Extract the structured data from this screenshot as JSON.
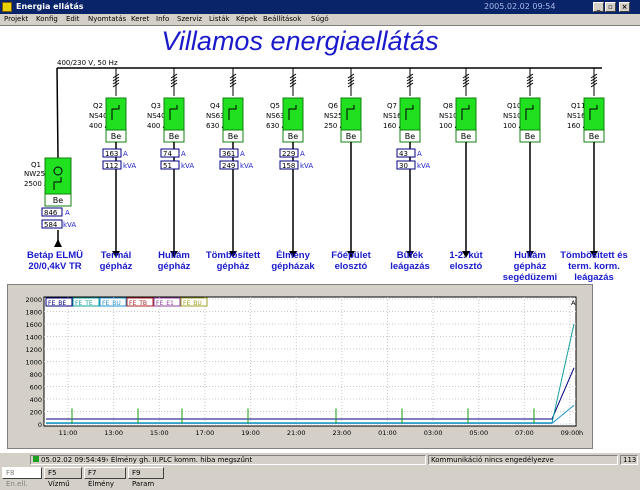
{
  "window": {
    "title": "Energia ellátás",
    "datetime": "2005.02.02  09:54"
  },
  "window_buttons": [
    "_",
    "▫",
    "×"
  ],
  "menu": [
    "Projekt",
    "Konfig",
    "Edit",
    "Nyomtatás",
    "Keret",
    "Info",
    "Szerviz",
    "Listák",
    "Képek",
    "Beállítások",
    "Súgó"
  ],
  "heading": "Villamos energiaellátás",
  "busbar_label": "400/230 V, 50 Hz",
  "main_breaker": {
    "id": "Q1",
    "type": "NW25H1",
    "rating": "2500 A",
    "state": "Be",
    "current": "846",
    "power": "584",
    "label1": "Betáp ELMÜ",
    "label2": "20/0,4kV TR"
  },
  "units": {
    "amp": "A",
    "kva": "kVA"
  },
  "feeders": [
    {
      "id": "Q2",
      "type": "NS400",
      "rating": "400 A",
      "state": "Be",
      "current": "163",
      "power": "112",
      "label1": "Termál",
      "label2": "gépház",
      "label3": "",
      "has_meter": true
    },
    {
      "id": "Q3",
      "type": "NS400",
      "rating": "400 A",
      "state": "Be",
      "current": "74",
      "power": "51",
      "label1": "Hullám",
      "label2": "gépház",
      "label3": "",
      "has_meter": true
    },
    {
      "id": "Q4",
      "type": "NS630",
      "rating": "630 A",
      "state": "Be",
      "current": "361",
      "power": "249",
      "label1": "Tömbösített",
      "label2": "gépház",
      "label3": "",
      "has_meter": true
    },
    {
      "id": "Q5",
      "type": "NS630",
      "rating": "630 A",
      "state": "Be",
      "current": "229",
      "power": "158",
      "label1": "Élmény",
      "label2": "gépházak",
      "label3": "",
      "has_meter": true
    },
    {
      "id": "Q6",
      "type": "NS250",
      "rating": "250 A",
      "state": "Be",
      "current": "",
      "power": "",
      "label1": "Főépület",
      "label2": "elosztó",
      "label3": "",
      "has_meter": false
    },
    {
      "id": "Q7",
      "type": "NS160",
      "rating": "160 A",
      "state": "Be",
      "current": "43",
      "power": "30",
      "label1": "Büfék",
      "label2": "leágazás",
      "label3": "",
      "has_meter": true
    },
    {
      "id": "Q8",
      "type": "NS100",
      "rating": "100 A",
      "state": "Be",
      "current": "",
      "power": "",
      "label1": "1-2. kút",
      "label2": "elosztó",
      "label3": "",
      "has_meter": false
    },
    {
      "id": "Q10",
      "type": "NS100",
      "rating": "100 A",
      "state": "Be",
      "current": "",
      "power": "",
      "label1": "Hullám",
      "label2": "gépház",
      "label3": "segédüzemi",
      "has_meter": false
    },
    {
      "id": "Q11",
      "type": "NS160",
      "rating": "160 A",
      "state": "Be",
      "current": "",
      "power": "",
      "label1": "Tömbösített és",
      "label2": "term. korm.",
      "label3": "leágazás",
      "has_meter": false
    }
  ],
  "chart": {
    "legend": [
      "FE_BE",
      "FE_TE",
      "FE_BU",
      "FE_TB",
      "FE_E1",
      "FE_BU"
    ],
    "legend_colors": [
      "#000080",
      "#10a0a0",
      "#2090d0",
      "#b02020",
      "#9040a0",
      "#a0a020"
    ],
    "y_ticks": [
      "2000",
      "1800",
      "1600",
      "1400",
      "1200",
      "1000",
      "800",
      "600",
      "400",
      "200",
      "0"
    ],
    "x_ticks": [
      "11:00",
      "13:00",
      "15:00",
      "17:00",
      "19:00",
      "21:00",
      "23:00",
      "01:00",
      "03:00",
      "05:00",
      "07:00",
      "09:00"
    ],
    "x_unit": "h",
    "unit_marker": "A"
  },
  "chart_data": {
    "type": "line",
    "title": "",
    "xlabel": "h",
    "ylabel": "A",
    "ylim": [
      0,
      2000
    ],
    "x": [
      "10:00",
      "11:00",
      "12:00",
      "13:00",
      "14:00",
      "15:00",
      "16:00",
      "17:00",
      "18:00",
      "19:00",
      "20:00",
      "21:00",
      "22:00",
      "23:00",
      "24:00",
      "01:00",
      "02:00",
      "03:00",
      "04:00",
      "05:00",
      "06:00",
      "07:00",
      "08:00",
      "09:00",
      "09:50"
    ],
    "series": [
      {
        "name": "FE_BE",
        "values": [
          80,
          80,
          80,
          80,
          80,
          80,
          80,
          80,
          80,
          80,
          80,
          80,
          80,
          80,
          80,
          80,
          80,
          80,
          80,
          80,
          80,
          80,
          80,
          80,
          900
        ]
      },
      {
        "name": "FE_TE",
        "values": [
          20,
          20,
          20,
          20,
          20,
          20,
          20,
          20,
          20,
          20,
          20,
          20,
          20,
          20,
          20,
          20,
          20,
          20,
          20,
          20,
          20,
          20,
          20,
          20,
          1600
        ]
      },
      {
        "name": "FE_BU",
        "values": [
          10,
          10,
          10,
          10,
          10,
          10,
          10,
          10,
          10,
          10,
          10,
          10,
          10,
          10,
          10,
          10,
          10,
          10,
          10,
          10,
          10,
          10,
          10,
          10,
          300
        ]
      }
    ],
    "grid": true,
    "legend_position": "top-left"
  }
}
